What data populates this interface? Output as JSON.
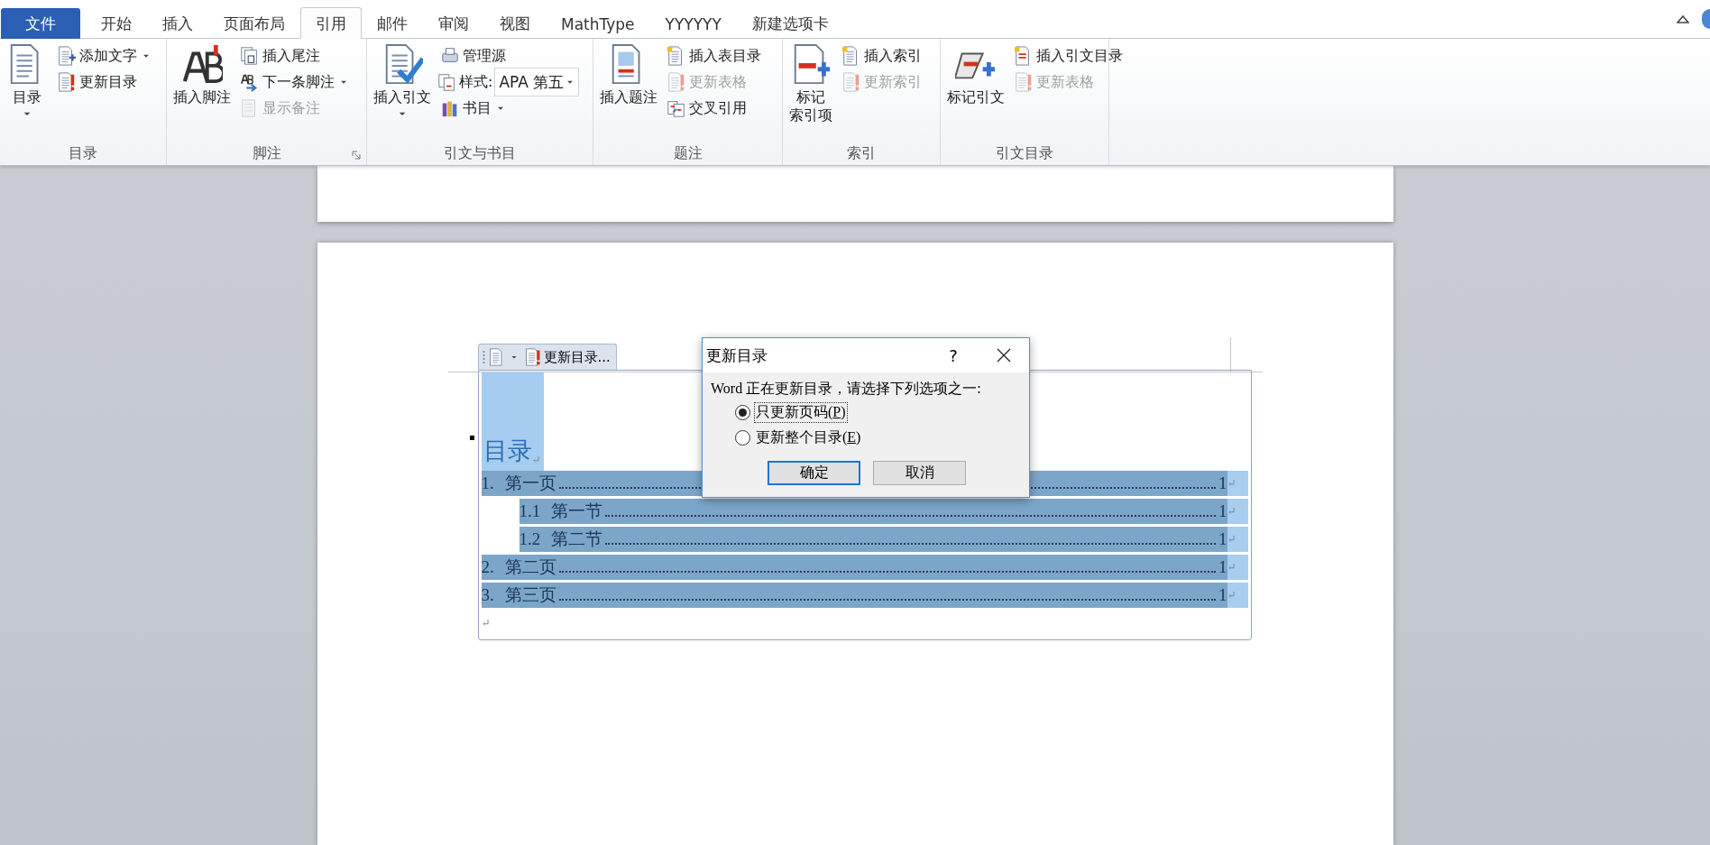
{
  "tabs": [
    {
      "label": "文件",
      "kind": "file",
      "selected": false
    },
    {
      "label": "开始",
      "kind": "tab",
      "selected": false
    },
    {
      "label": "插入",
      "kind": "tab",
      "selected": false
    },
    {
      "label": "页面布局",
      "kind": "tab",
      "selected": false
    },
    {
      "label": "引用",
      "kind": "tab",
      "selected": true
    },
    {
      "label": "邮件",
      "kind": "tab",
      "selected": false
    },
    {
      "label": "审阅",
      "kind": "tab",
      "selected": false
    },
    {
      "label": "视图",
      "kind": "tab",
      "selected": false
    },
    {
      "label": "MathType",
      "kind": "tab",
      "selected": false
    },
    {
      "label": "YYYYYY",
      "kind": "tab",
      "selected": false
    },
    {
      "label": "新建选项卡",
      "kind": "tab",
      "selected": false
    }
  ],
  "ribbon": {
    "groups": [
      {
        "label": "目录",
        "launcher": false,
        "items": [
          {
            "kind": "large",
            "label": "目录",
            "dropdown": true
          },
          {
            "kind": "column",
            "items": [
              {
                "kind": "button",
                "label": "添加文字",
                "dropdown": true,
                "disabled": false
              },
              {
                "kind": "button",
                "label": "更新目录",
                "dropdown": false,
                "disabled": false
              }
            ]
          }
        ]
      },
      {
        "label": "脚注",
        "launcher": true,
        "items": [
          {
            "kind": "large",
            "label": "插入脚注",
            "dropdown": false
          },
          {
            "kind": "column",
            "items": [
              {
                "kind": "button",
                "label": "插入尾注",
                "dropdown": false,
                "disabled": false
              },
              {
                "kind": "button",
                "label": "下一条脚注",
                "dropdown": true,
                "disabled": false
              },
              {
                "kind": "button",
                "label": "显示备注",
                "dropdown": false,
                "disabled": true
              }
            ]
          }
        ]
      },
      {
        "label": "引文与书目",
        "launcher": false,
        "items": [
          {
            "kind": "large",
            "label": "插入引文",
            "dropdown": true
          },
          {
            "kind": "column",
            "items": [
              {
                "kind": "button",
                "label": "管理源",
                "dropdown": false,
                "disabled": false
              },
              {
                "kind": "combo",
                "label": "样式:",
                "value": "APA 第五"
              },
              {
                "kind": "button",
                "label": "书目",
                "dropdown": true,
                "disabled": false
              }
            ]
          }
        ]
      },
      {
        "label": "题注",
        "launcher": false,
        "items": [
          {
            "kind": "large",
            "label": "插入题注",
            "dropdown": false
          },
          {
            "kind": "column",
            "items": [
              {
                "kind": "button",
                "label": "插入表目录",
                "dropdown": false,
                "disabled": false
              },
              {
                "kind": "button",
                "label": "更新表格",
                "dropdown": false,
                "disabled": true
              },
              {
                "kind": "button",
                "label": "交叉引用",
                "dropdown": false,
                "disabled": false
              }
            ]
          }
        ]
      },
      {
        "label": "索引",
        "launcher": false,
        "items": [
          {
            "kind": "large",
            "label_lines": [
              "标记",
              "索引项"
            ],
            "dropdown": false
          },
          {
            "kind": "column",
            "items": [
              {
                "kind": "button",
                "label": "插入索引",
                "dropdown": false,
                "disabled": false
              },
              {
                "kind": "button",
                "label": "更新索引",
                "dropdown": false,
                "disabled": true
              }
            ]
          }
        ]
      },
      {
        "label": "引文目录",
        "launcher": false,
        "items": [
          {
            "kind": "large",
            "label": "标记引文",
            "dropdown": false
          },
          {
            "kind": "column",
            "items": [
              {
                "kind": "button",
                "label": "插入引文目录",
                "dropdown": false,
                "disabled": false
              },
              {
                "kind": "button",
                "label": "更新表格",
                "dropdown": false,
                "disabled": true
              }
            ]
          }
        ]
      }
    ]
  },
  "document": {
    "control_toolbar": {
      "button": "更新目录..."
    },
    "heading": "目录",
    "heading_mark": "↵",
    "toc": [
      {
        "number": "1.",
        "title": "第一页",
        "page": "1",
        "mark": "↵",
        "indented": false
      },
      {
        "number": "1.1",
        "title": "第一节",
        "page": "1",
        "mark": "↵",
        "indented": true
      },
      {
        "number": "1.2",
        "title": "第二节",
        "page": "1",
        "mark": "↵",
        "indented": true
      },
      {
        "number": "2.",
        "title": "第二页",
        "page": "1",
        "mark": "↵",
        "indented": false
      },
      {
        "number": "3.",
        "title": "第三页",
        "page": "1",
        "mark": "↵",
        "indented": false
      }
    ],
    "end_mark": "↵"
  },
  "dialog": {
    "title": "更新目录",
    "help": "?",
    "message": "Word 正在更新目录，请选择下列选项之一:",
    "options": [
      {
        "label": "只更新页码(P)",
        "selected": true,
        "focused": true
      },
      {
        "label": "更新整个目录(E)",
        "selected": false,
        "focused": false
      }
    ],
    "buttons": [
      {
        "label": "确定",
        "default": true
      },
      {
        "label": "取消",
        "default": false
      }
    ]
  }
}
